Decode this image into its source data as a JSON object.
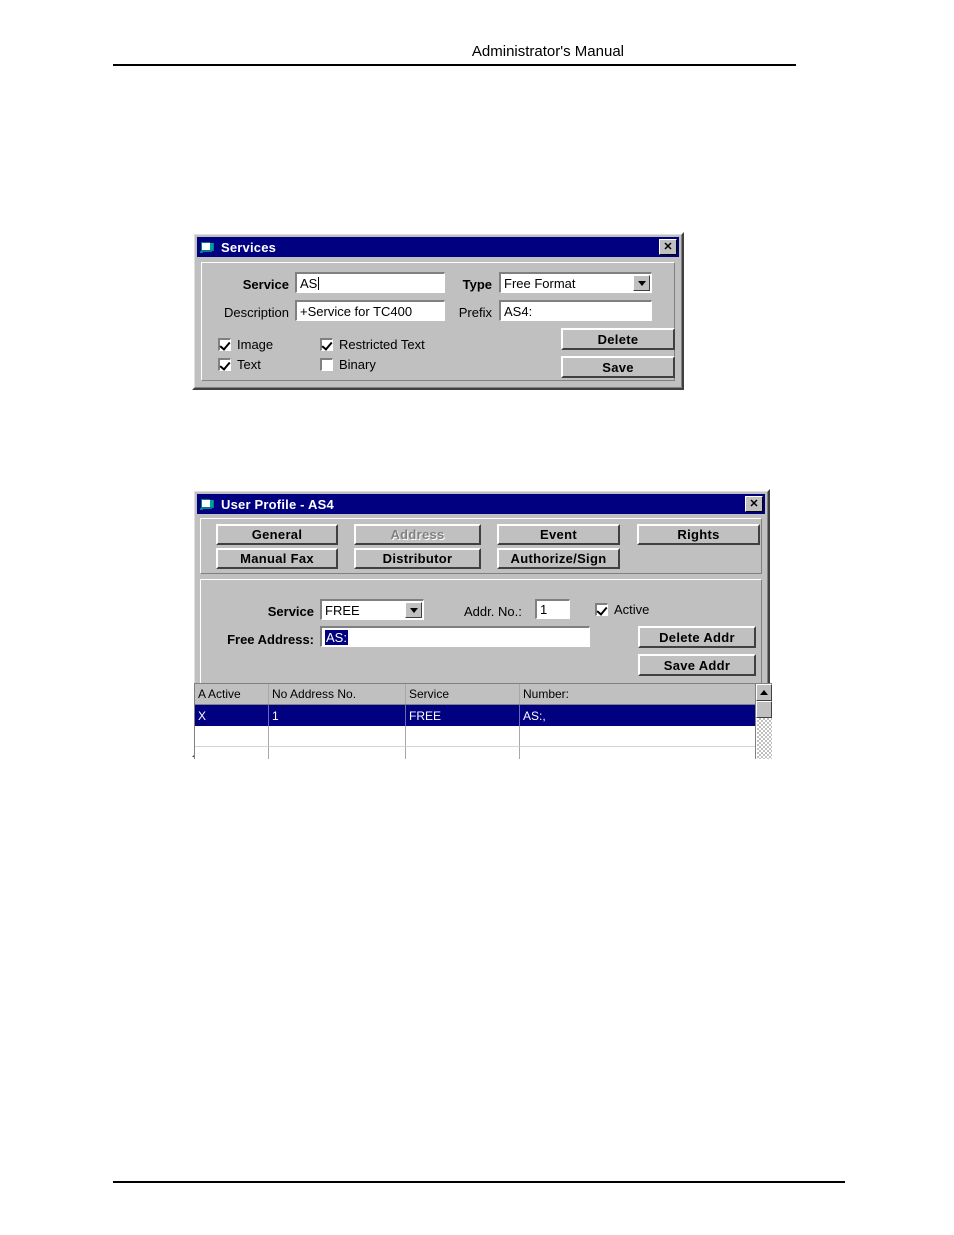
{
  "page": {
    "header_title": "Administrator's Manual"
  },
  "services_dialog": {
    "title": "Services",
    "icon": "document-window-icon",
    "close_label": "✕",
    "service_label": "Service",
    "service_value": "AS",
    "description_label": "Description",
    "description_value": "+Service for TC400",
    "type_label": "Type",
    "type_value": "Free Format",
    "prefix_label": "Prefix",
    "prefix_value": "AS4:",
    "checkboxes": [
      {
        "label": "Image",
        "checked": true
      },
      {
        "label": "Text",
        "checked": true
      },
      {
        "label": "Restricted Text",
        "checked": true
      },
      {
        "label": "Binary",
        "checked": false
      }
    ],
    "delete_label": "Delete",
    "save_label": "Save"
  },
  "user_profile_dialog": {
    "title": "User Profile - AS4",
    "icon": "document-window-icon",
    "close_label": "✕",
    "nav_buttons": [
      {
        "label": "General",
        "disabled": false
      },
      {
        "label": "Address",
        "disabled": true
      },
      {
        "label": "Event",
        "disabled": false
      },
      {
        "label": "Rights",
        "disabled": false
      },
      {
        "label": "Manual Fax",
        "disabled": false
      },
      {
        "label": "Distributor",
        "disabled": false
      },
      {
        "label": "Authorize/Sign",
        "disabled": false
      }
    ],
    "service_label": "Service",
    "service_value": "FREE",
    "addr_no_label": "Addr. No.:",
    "addr_no_value": "1",
    "active_label": "Active",
    "active_checked": true,
    "free_address_label": "Free Address:",
    "free_address_value": "AS:",
    "delete_addr_label": "Delete Addr",
    "save_addr_label": "Save Addr",
    "grid": {
      "columns": [
        "A Active",
        "No Address No.",
        "Service",
        "Number:"
      ],
      "rows": [
        {
          "cells": [
            "X",
            "1",
            "FREE",
            "AS:,"
          ],
          "selected": true
        },
        {
          "cells": [
            "",
            "",
            "",
            ""
          ],
          "selected": false
        },
        {
          "cells": [
            "",
            "",
            "",
            ""
          ],
          "selected": false
        }
      ],
      "scroll_up_icon": "triangle-up-icon"
    }
  },
  "colors": {
    "titlebar": "#000080",
    "face": "#c0c0c0",
    "selection": "#000080"
  }
}
